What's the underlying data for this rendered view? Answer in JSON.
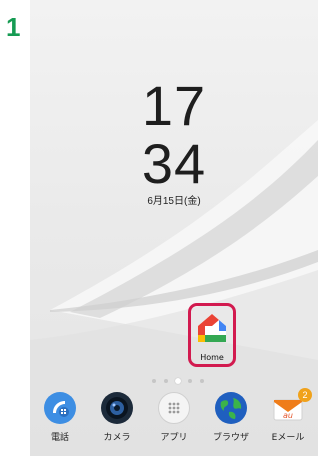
{
  "step_number": "1",
  "clock": {
    "hour": "17",
    "minute": "34",
    "date": "6月15日(金)"
  },
  "home_app": {
    "label": "Home"
  },
  "page_indicator": {
    "count": 5,
    "active_index": 2
  },
  "dock": [
    {
      "label": "電話",
      "icon": "phone-icon"
    },
    {
      "label": "カメラ",
      "icon": "camera-icon"
    },
    {
      "label": "アプリ",
      "icon": "apps-icon"
    },
    {
      "label": "ブラウザ",
      "icon": "browser-icon"
    },
    {
      "label": "Eメール",
      "icon": "email-icon",
      "badge": "2"
    }
  ],
  "colors": {
    "step": "#169b53",
    "highlight": "#d21a4f",
    "badge": "#f0a21b"
  }
}
